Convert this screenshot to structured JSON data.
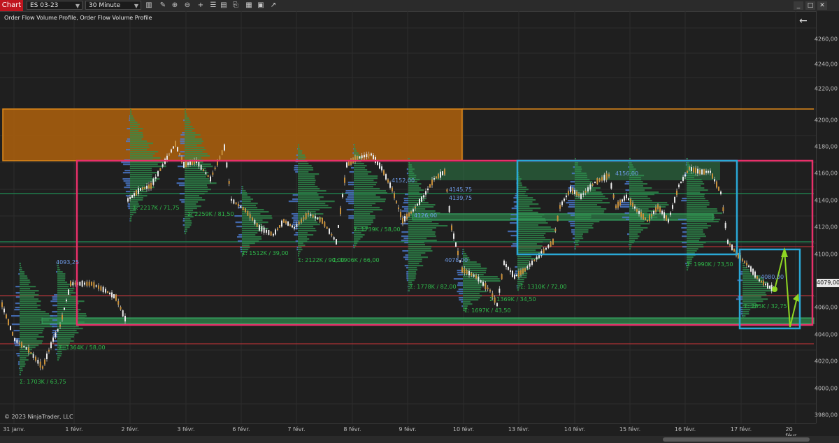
{
  "toolbar": {
    "chart_tab": "Chart",
    "instrument": "ES 03-23",
    "timeframe": "30 Minute",
    "icons": [
      "bar-chart-icon",
      "pencil-icon",
      "magnify-plus-icon",
      "magnify-minus-icon",
      "crosshair-icon",
      "properties-icon",
      "strategy-icon",
      "template-icon",
      "data-box-icon",
      "snapshot-icon"
    ]
  },
  "window_controls": [
    "_",
    "□",
    "✕"
  ],
  "indicator_label": "Order Flow Volume Profile, Order Flow Volume Profile",
  "back_arrow": "←",
  "copyright": "© 2023 NinjaTrader, LLC",
  "price_axis": {
    "ticks": [
      "4260,00",
      "4240,00",
      "4220,00",
      "4200,00",
      "4180,00",
      "4160,00",
      "4140,00",
      "4120,00",
      "4100,00",
      "4080,00",
      "4060,00",
      "4040,00",
      "4020,00",
      "4000,00",
      "3980,00"
    ],
    "last_price": "4079,00"
  },
  "time_axis": [
    "31 janv.",
    "1 févr.",
    "2 févr.",
    "3 févr.",
    "6 févr.",
    "7 févr.",
    "8 févr.",
    "9 févr.",
    "10 févr.",
    "13 févr.",
    "14 févr.",
    "15 févr.",
    "16 févr.",
    "17 févr.",
    "20 févr."
  ],
  "profile_labels": [
    "Σ: 1703K / 63,75",
    "Σ: 1364K / 58,00",
    "Σ: 2217K / 71,75",
    "Σ: 2259K / 81,50",
    "Σ: 1512K / 39,00",
    "Σ: 2122K / 90,00",
    "Σ: 1906K / 66,00",
    "Σ: 1739K / 58,00",
    "Σ: 1778K / 82,00",
    "Σ: 1697K / 43,50",
    "Σ: 1369K / 34,50",
    "Σ: 1310K / 72,00",
    "Σ: 1990K / 73,50",
    "Σ: 285K / 32,75"
  ],
  "level_labels": [
    "4093,25",
    "4080,00",
    "4156,00",
    "4152,00",
    "4145,75",
    "4139,75",
    "4126,00",
    "4078,00"
  ],
  "colors": {
    "supply_zone": "#b8650b",
    "range_box": "#e8306a",
    "consolidation_box": "#2aa8d6",
    "green_line": "#1fa860",
    "red_line": "#d0353a",
    "arrow": "#8fd623",
    "profile_green": "#2f8f4e",
    "profile_blue": "#4b7bd0"
  }
}
